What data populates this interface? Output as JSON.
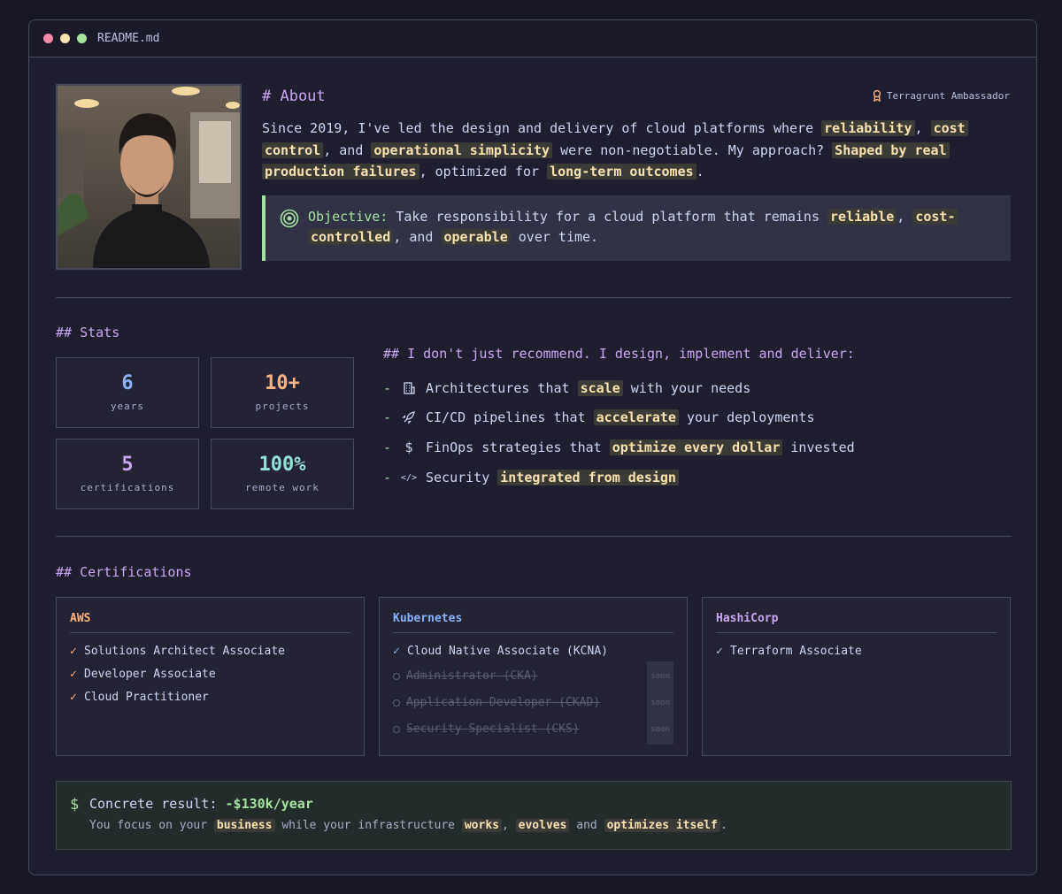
{
  "window": {
    "title": "README.md"
  },
  "about": {
    "heading": "# About",
    "badge": "Terragrunt Ambassador",
    "p_1": "Since 2019, I've led the design and delivery of cloud platforms where",
    "hl_reliability": "reliability",
    "p_2": ",",
    "hl_cost": "cost",
    "hl_control": "control",
    "p_3": ", and",
    "hl_operational": "operational simplicity",
    "p_4": "were non-negotiable. My approach?",
    "hl_shaped": "Shaped by real",
    "hl_production": "production failures",
    "p_5": ", optimized for",
    "hl_longterm": "long-term outcomes",
    "p_6": ".",
    "objective": {
      "label": "Objective:",
      "t1": "Take responsibility for a cloud platform that remains",
      "hl_reliable": "reliable",
      "t2": ",",
      "hl_cost": "cost-",
      "hl_controlled": "controlled",
      "t3": ", and",
      "hl_operable": "operable",
      "t4": "over time."
    }
  },
  "stats": {
    "heading": "## Stats",
    "items": [
      {
        "value": "6",
        "label": "years",
        "color": "#89b4fa"
      },
      {
        "value": "10+",
        "label": "projects",
        "color": "#fab387"
      },
      {
        "value": "5",
        "label": "certifications",
        "color": "#cba6f7"
      },
      {
        "value": "100%",
        "label": "remote work",
        "color": "#94e2d5"
      }
    ]
  },
  "deliver": {
    "heading": "## I don't just recommend. I design, implement and deliver:",
    "items": [
      {
        "dash": "-",
        "icon": "building-icon",
        "pre": "Architectures that",
        "hl": "scale",
        "post": "with your needs"
      },
      {
        "dash": "-",
        "icon": "rocket-icon",
        "pre": "CI/CD pipelines that",
        "hl": "accelerate",
        "post": "your deployments"
      },
      {
        "dash": "-",
        "icon": "dollar-icon",
        "icon_glyph": "$",
        "pre": "FinOps strategies that",
        "hl": "optimize every dollar",
        "post": "invested"
      },
      {
        "dash": "-",
        "icon": "code-icon",
        "icon_glyph": "</>",
        "pre": "Security",
        "hl": "integrated from design",
        "post": ""
      }
    ]
  },
  "certifications": {
    "heading": "## Certifications",
    "groups": [
      {
        "name": "AWS",
        "color": "#fab387",
        "items": [
          {
            "check": "✓",
            "label": "Solutions Architect Associate"
          },
          {
            "check": "✓",
            "label": "Developer Associate"
          },
          {
            "check": "✓",
            "label": "Cloud Practitioner"
          }
        ]
      },
      {
        "name": "Kubernetes",
        "color": "#89b4fa",
        "items": [
          {
            "check": "✓",
            "label": "Cloud Native Associate (KCNA)"
          },
          {
            "label": "Administrator (CKA)",
            "badge": "soon"
          },
          {
            "label": "Application Developer (CKAD)",
            "badge": "soon"
          },
          {
            "label": "Security Specialist (CKS)",
            "badge": "soon"
          }
        ]
      },
      {
        "name": "HashiCorp",
        "color": "#cba6f7",
        "items": [
          {
            "check": "✓",
            "label": "Terraform Associate"
          }
        ]
      }
    ]
  },
  "result": {
    "dollar": "$",
    "title": "Concrete result:",
    "value": "-$130k/year",
    "t1": "You focus on your",
    "hl_business": "business",
    "t2": "while your infrastructure",
    "hl_works": "works",
    "t3": ",",
    "hl_evolves": "evolves",
    "t4": "and",
    "hl_optimizes": "optimizes itself",
    "t5": "."
  },
  "colors": {
    "green": "#a6e3a1",
    "purple": "#cba6f7",
    "highlight": "#f9e2af",
    "orange": "#fab387",
    "blue": "#89b4fa"
  }
}
